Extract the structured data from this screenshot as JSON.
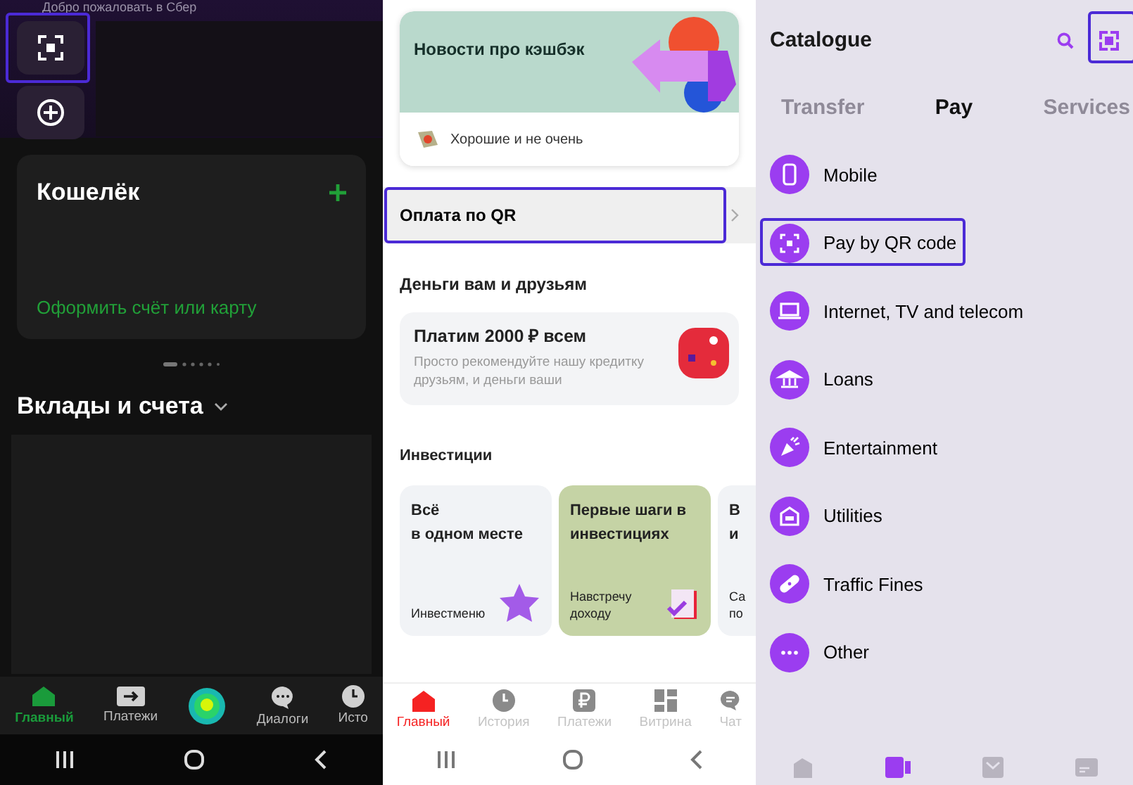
{
  "sber": {
    "greeting": "Добро пожаловать в Сбер",
    "quick_buttons": [
      {
        "kind": "qr",
        "annotated": true
      },
      {
        "kind": "add"
      }
    ],
    "wallet": {
      "title": "Кошелёк",
      "link": "Оформить счёт или карту"
    },
    "section": "Вклады и счета",
    "nav": [
      {
        "kind": "tab",
        "label": "Главный",
        "selected": true
      },
      {
        "kind": "tab",
        "label": "Платежи",
        "selected": false
      },
      {
        "kind": "assistant",
        "selected": false
      },
      {
        "kind": "tab",
        "label": "Диалоги",
        "selected": false
      },
      {
        "kind": "tab",
        "label": "Исто",
        "selected": false
      }
    ]
  },
  "tinkoff": {
    "cashback": {
      "title": "Новости про кэшбэк",
      "subtitle": "Хорошие и не очень"
    },
    "qr_row": {
      "label": "Оплата по QR",
      "annotated": true
    },
    "friends": {
      "title": "Деньги вам и друзьям",
      "promo_title": "Платим 2000 ₽ всем",
      "promo_text": "Просто рекомендуйте нашу кредитку друзьям, и деньги ваши"
    },
    "invest": {
      "title": "Инвестиции",
      "cards": [
        {
          "title": [
            "Всё",
            "в одном месте"
          ],
          "caption": [
            "Инвестменю"
          ],
          "color": "#f1f3f6"
        },
        {
          "title": [
            "Первые шаги в",
            "инвестициях"
          ],
          "caption": [
            "Навстречу",
            "доходу"
          ],
          "color": "#c5d3a5"
        },
        {
          "title": [
            "В",
            "и"
          ],
          "caption": [
            "Са",
            "по"
          ],
          "color": "#f1f3f6"
        }
      ]
    },
    "nav": [
      {
        "label": "Главный",
        "selected": true
      },
      {
        "label": "История",
        "selected": false
      },
      {
        "label": "Платежи",
        "selected": false
      },
      {
        "label": "Витрина",
        "selected": false
      },
      {
        "label": "Чат",
        "selected": false
      }
    ]
  },
  "catalogue": {
    "title": "Catalogue",
    "qr_annotated": true,
    "tabs": [
      {
        "label": "Transfer",
        "selected": false
      },
      {
        "label": "Pay",
        "selected": true
      },
      {
        "label": "Services",
        "selected": false
      }
    ],
    "items": [
      {
        "label": "Mobile",
        "annotated": false
      },
      {
        "label": "Pay by QR code",
        "annotated": true
      },
      {
        "label": "Internet, TV and telecom",
        "annotated": false
      },
      {
        "label": "Loans",
        "annotated": false
      },
      {
        "label": "Entertainment",
        "annotated": false
      },
      {
        "label": "Utilities",
        "annotated": false
      },
      {
        "label": "Traffic Fines",
        "annotated": false
      },
      {
        "label": "Other",
        "annotated": false
      }
    ],
    "nav": [
      {
        "selected": false
      },
      {
        "selected": true
      },
      {
        "selected": false
      },
      {
        "selected": false
      }
    ]
  }
}
